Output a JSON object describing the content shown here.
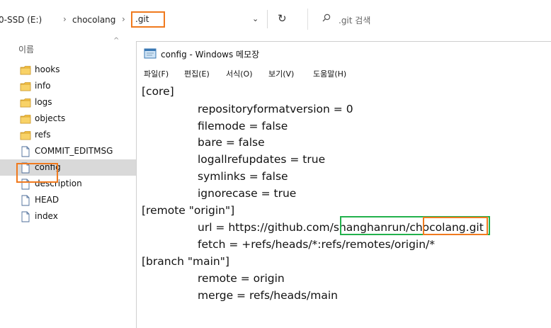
{
  "address_bar": {
    "drive": "0-SSD (E:)",
    "folder": "chocolang",
    "current": ".git",
    "search_placeholder": ".git 검색",
    "icons": [
      "chevron-right-icon",
      "chevron-down-icon",
      "refresh-icon",
      "search-icon"
    ]
  },
  "file_list": {
    "column_header": "이름",
    "items": [
      {
        "name": "hooks",
        "type": "folder"
      },
      {
        "name": "info",
        "type": "folder"
      },
      {
        "name": "logs",
        "type": "folder"
      },
      {
        "name": "objects",
        "type": "folder"
      },
      {
        "name": "refs",
        "type": "folder"
      },
      {
        "name": "COMMIT_EDITMSG",
        "type": "file"
      },
      {
        "name": "config",
        "type": "file",
        "selected": true
      },
      {
        "name": "description",
        "type": "file"
      },
      {
        "name": "HEAD",
        "type": "file"
      },
      {
        "name": "index",
        "type": "file"
      }
    ]
  },
  "notepad": {
    "title": "config - Windows 메모장",
    "menu": [
      "파일(F)",
      "편집(E)",
      "서식(O)",
      "보기(V)",
      "도움말(H)"
    ],
    "lines": {
      "core": "[core]",
      "repositoryformatversion": "repositoryformatversion = 0",
      "filemode": "filemode = false",
      "bare": "bare = false",
      "logallrefupdates": "logallrefupdates = true",
      "symlinks": "symlinks = false",
      "ignorecase": "ignorecase = true",
      "remote": "[remote \"origin\"]",
      "url_prefix": "url = https://github.com",
      "url_user": "/shanghanrun",
      "url_repo": "/chocolang",
      "url_suffix": ".git",
      "fetch": "fetch = +refs/heads/*:refs/remotes/origin/*",
      "branch": "[branch \"main\"]",
      "branch_remote": "remote = origin",
      "branch_merge": "merge = refs/heads/main"
    }
  },
  "colors": {
    "highlight_orange": "#f07a1e",
    "highlight_green": "#22b14c",
    "folder_yellow": "#f5c242",
    "selected_row": "#d9d9d9"
  }
}
